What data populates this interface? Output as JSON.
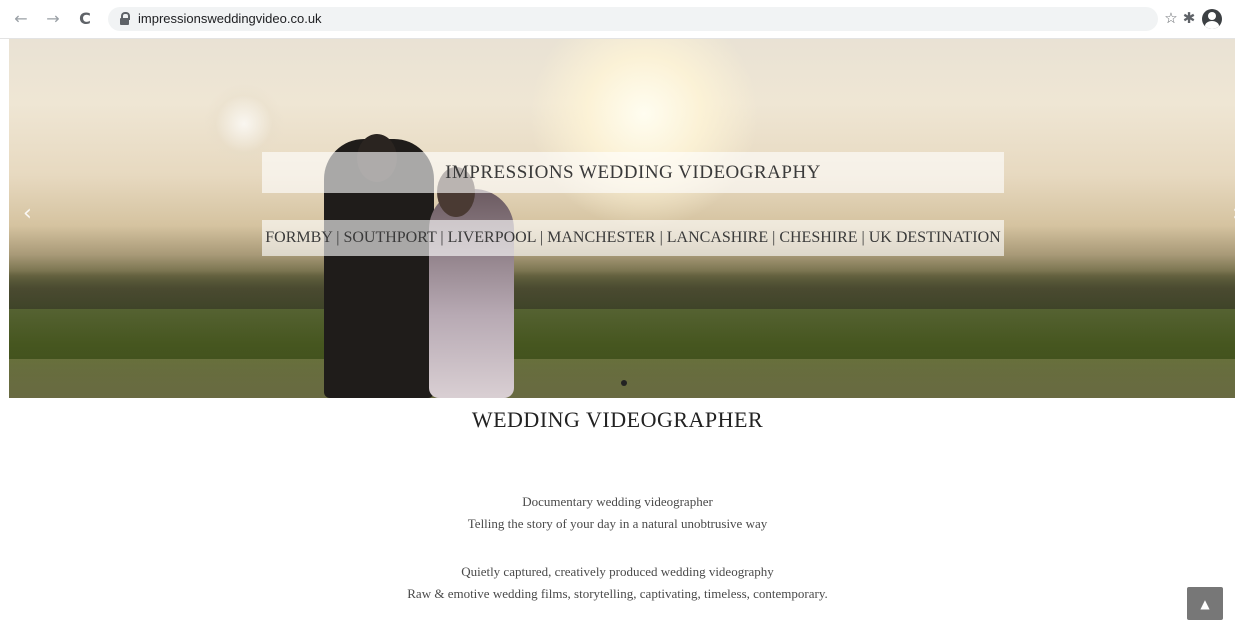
{
  "browser": {
    "url": "impressionsweddingvideo.co.uk",
    "back_icon": "←",
    "forward_icon": "→",
    "reload_icon": "C",
    "star_icon": "☆",
    "extensions_icon": "✱"
  },
  "hero": {
    "title": "IMPRESSIONS WEDDING VIDEOGRAPHY",
    "locations": "FORMBY | SOUTHPORT | LIVERPOOL | MANCHESTER | LANCASHIRE | CHESHIRE | UK DESTINATION",
    "prev_icon": "‹",
    "next_icon": "›"
  },
  "main": {
    "heading": "WEDDING VIDEOGRAPHER",
    "para1_line1": "Documentary wedding videographer",
    "para1_line2": "Telling the story of your day in a natural unobtrusive way",
    "para2_line1": "Quietly captured, creatively produced wedding videography",
    "para2_line2": "Raw & emotive wedding films, storytelling, captivating, timeless, contemporary."
  },
  "scroll_top": {
    "icon": "▲"
  }
}
